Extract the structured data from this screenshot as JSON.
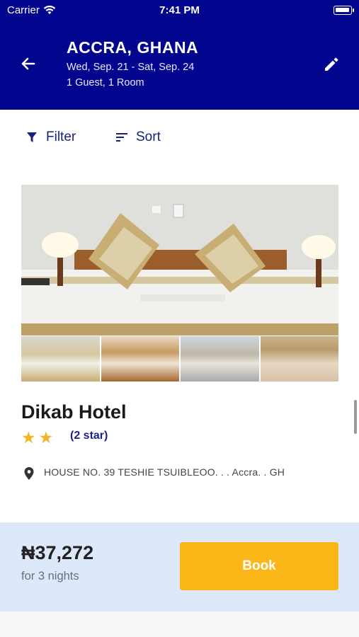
{
  "status_bar": {
    "carrier": "Carrier",
    "time": "7:41 PM"
  },
  "header": {
    "title": "ACCRA, GHANA",
    "dates": "Wed, Sep. 21 - Sat, Sep. 24",
    "guests": "1 Guest, 1 Room",
    "back_icon": "arrow-left-icon",
    "edit_icon": "pencil-icon",
    "background_color": "#02068e"
  },
  "toolbar": {
    "filter_label": "Filter",
    "sort_label": "Sort"
  },
  "hotel": {
    "name": "Dikab Hotel",
    "star_count": 2,
    "star_label": "(2 star)",
    "address": "HOUSE NO. 39 TESHIE TSUIBLEOO. . . Accra. . GH",
    "price": "₦37,272",
    "nights": "for 3 nights"
  },
  "book_button": {
    "label": "Book",
    "color": "#fbb617"
  }
}
